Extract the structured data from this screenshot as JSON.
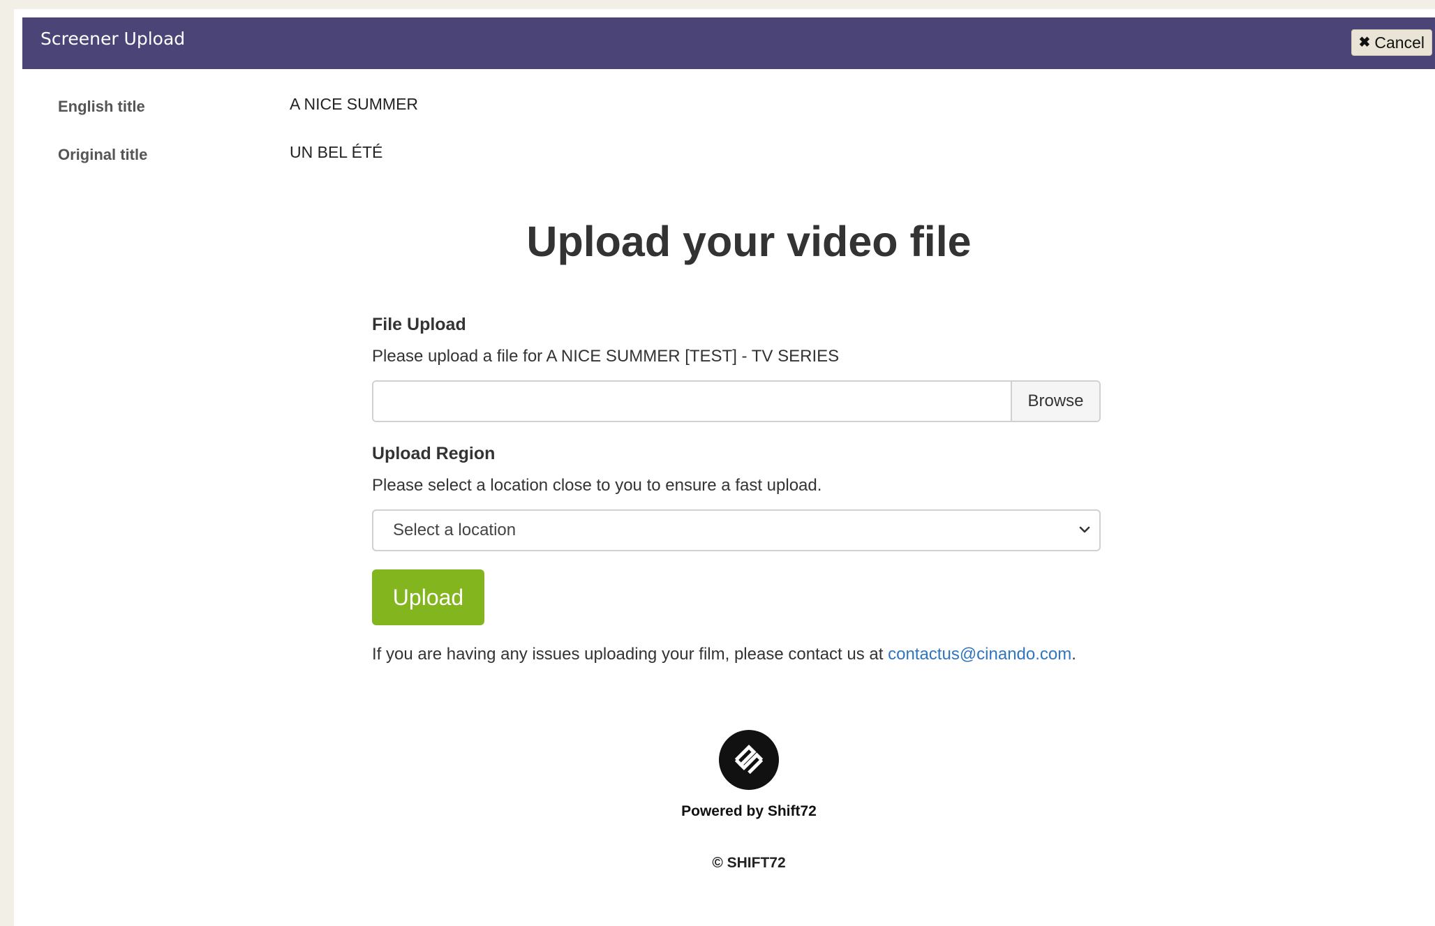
{
  "dialog": {
    "title": "Screener Upload",
    "cancel_label": "Cancel"
  },
  "meta": {
    "english_title_label": "English title",
    "english_title_value": "A NICE SUMMER",
    "original_title_label": "Original title",
    "original_title_value": "UN BEL ÉTÉ"
  },
  "main": {
    "heading": "Upload your video file",
    "file_upload": {
      "label": "File Upload",
      "description": "Please upload a file for A NICE SUMMER [TEST] - TV SERIES",
      "value": "",
      "browse_label": "Browse"
    },
    "region": {
      "label": "Upload Region",
      "description": "Please select a location close to you to ensure a fast upload.",
      "selected": "Select a location"
    },
    "upload_label": "Upload",
    "help_prefix": "If you are having any issues uploading your film, please contact us at ",
    "help_email": "contactus@cinando.com",
    "help_suffix": "."
  },
  "footer": {
    "powered_by": "Powered by Shift72",
    "copyright": "© SHIFT72"
  },
  "colors": {
    "header_bg": "#4b4476",
    "upload_button": "#82b51e",
    "link": "#2f75c0"
  },
  "icons": {
    "cancel": "close-icon",
    "select": "chevron-down-icon",
    "logo": "shift72-logo-icon"
  }
}
